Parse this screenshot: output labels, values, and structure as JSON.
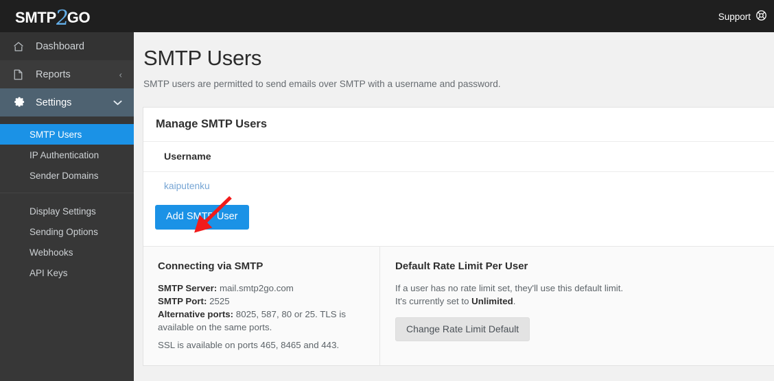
{
  "topbar": {
    "logo": {
      "part1": "SMTP",
      "part2": "2",
      "part3": "GO"
    },
    "support_label": "Support",
    "support_icon": "lifebuoy-icon"
  },
  "sidebar": {
    "items": [
      {
        "label": "Dashboard",
        "icon": "home-icon",
        "chevron": ""
      },
      {
        "label": "Reports",
        "icon": "document-icon",
        "chevron": "‹"
      },
      {
        "label": "Settings",
        "icon": "gear-icon",
        "chevron": "⌄"
      }
    ],
    "subitems_group1": [
      {
        "label": "SMTP Users",
        "active": true
      },
      {
        "label": "IP Authentication",
        "active": false
      },
      {
        "label": "Sender Domains",
        "active": false
      }
    ],
    "subitems_group2": [
      {
        "label": "Display Settings",
        "active": false
      },
      {
        "label": "Sending Options",
        "active": false
      },
      {
        "label": "Webhooks",
        "active": false
      },
      {
        "label": "API Keys",
        "active": false
      }
    ]
  },
  "page": {
    "title": "SMTP Users",
    "subtitle": "SMTP users are permitted to send emails over SMTP with a username and password."
  },
  "card": {
    "heading": "Manage SMTP Users",
    "table": {
      "columns": [
        "Username"
      ],
      "rows": [
        [
          "kaiputenku"
        ]
      ]
    },
    "add_button_label": "Add SMTP User"
  },
  "footer": {
    "left": {
      "title": "Connecting via SMTP",
      "server_label": "SMTP Server:",
      "server_value": "mail.smtp2go.com",
      "port_label": "SMTP Port:",
      "port_value": "2525",
      "alt_label": "Alternative ports:",
      "alt_value": "8025, 587, 80 or 25. TLS is available on the same ports.",
      "ssl_line": "SSL is available on ports 465, 8465 and 443."
    },
    "right": {
      "title": "Default Rate Limit Per User",
      "desc_line1": "If a user has no rate limit set, they'll use this default limit.",
      "desc_line2_pre": "It's currently set to ",
      "desc_line2_value": "Unlimited",
      "desc_line2_post": ".",
      "button_label": "Change Rate Limit Default"
    }
  },
  "annotation": {
    "arrow_color": "#f21b1b",
    "arrow_name": "red-pointer-arrow"
  },
  "colors": {
    "accent_blue": "#1b92e6",
    "sidebar_bg": "#373737",
    "topbar_bg": "#1f1f1f",
    "settings_row_bg": "#4e6271",
    "page_bg": "#f1f1f1"
  }
}
